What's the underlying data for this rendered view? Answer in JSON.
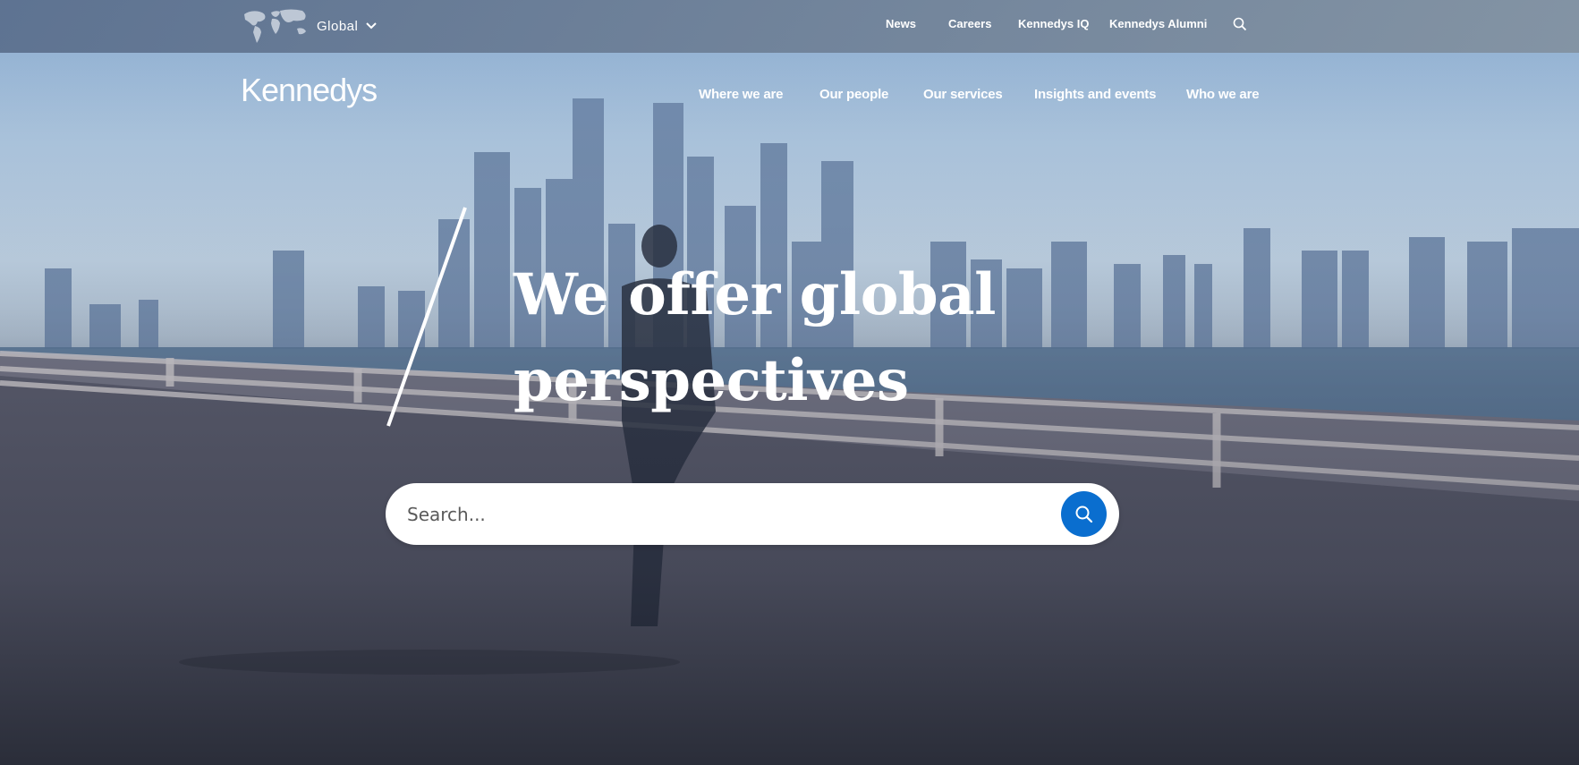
{
  "utility_bar": {
    "region_label": "Global",
    "links": [
      {
        "label": "News"
      },
      {
        "label": "Careers"
      },
      {
        "label": "Kennedys IQ"
      },
      {
        "label": "Kennedys Alumni"
      }
    ],
    "icons": [
      "world-map-icon",
      "chevron-down-icon",
      "search-icon"
    ]
  },
  "header": {
    "logo_text": "Kennedys",
    "nav": [
      {
        "label": "Where we are"
      },
      {
        "label": "Our people"
      },
      {
        "label": "Our services"
      },
      {
        "label": "Insights and events"
      },
      {
        "label": "Who we are"
      }
    ]
  },
  "hero": {
    "headline_line1": "We offer global",
    "headline_line2": "perspectives"
  },
  "search": {
    "placeholder": "Search...",
    "button_icon": "search-icon",
    "button_color": "#0a6ecf"
  },
  "colors": {
    "text": "#ffffff",
    "accent": "#0a6ecf"
  }
}
